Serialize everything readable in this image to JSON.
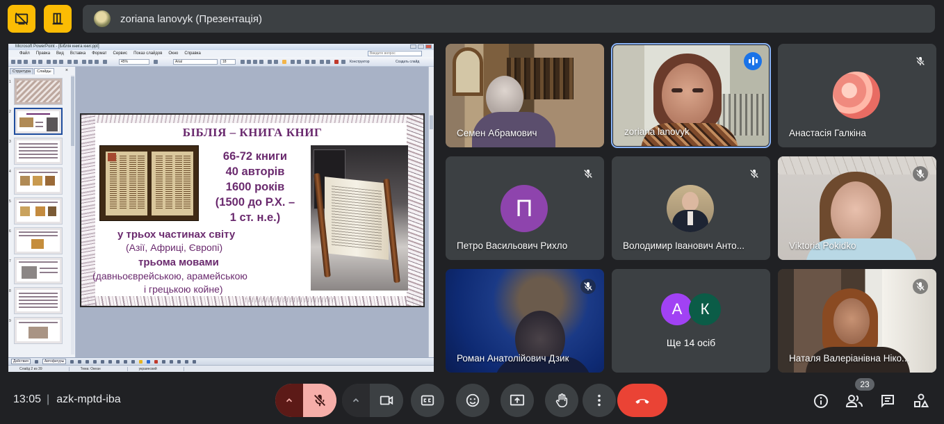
{
  "topbar": {
    "presenter_label": "zoriana lanovyk (Презентація)",
    "button_1_icon": "stop-presenting-icon",
    "button_2_icon": "present-layout-icon"
  },
  "presentation": {
    "app_title": "Microsoft PowerPoint - [Біблія книга книг.ppt]",
    "menu": [
      "Файл",
      "Правка",
      "Вид",
      "Вставка",
      "Формат",
      "Сервис",
      "Показ слайдов",
      "Окно",
      "Справка"
    ],
    "help_placeholder": "Введите вопрос",
    "zoom": "45%",
    "font_name": "Arial",
    "font_size": "18",
    "toolbar_design": "Конструктор",
    "toolbar_new_slide": "Создать слайд",
    "tabs": [
      "Структура",
      "Слайды"
    ],
    "thumb_numbers": [
      "1",
      "2",
      "3",
      "4",
      "5",
      "6",
      "7",
      "8",
      "9"
    ],
    "draw_label": "Действия",
    "autoshapes_label": "Автофигуры",
    "status": [
      "Слайд 2 из 39",
      "Тема: Океан",
      "украинский"
    ],
    "slide": {
      "title": "БІБЛІЯ – КНИГА КНИГ",
      "stats": [
        "66-72 книги",
        "40 авторів",
        "1600 років",
        "(1500 до Р.Х. –",
        "1 ст. н.е.)"
      ],
      "line1": "у трьох частинах світу",
      "line2": "(Азії, Африці, Європі)",
      "line3": "трьома мовами",
      "line4": "(давньоєврейською, арамейською",
      "line5": "і грецькою койне)"
    }
  },
  "participants": [
    {
      "name": "Семен Абрамович",
      "muted": false
    },
    {
      "name": "zoriana lanovyk",
      "speaking": true
    },
    {
      "name": "Анастасія Галкіна",
      "muted": true
    },
    {
      "name": "Петро Васильович Рихло",
      "avatar_letter": "П",
      "avatar_color": "#8e44ad",
      "muted": true
    },
    {
      "name": "Володимир Іванович Анто...",
      "muted": true
    },
    {
      "name": "Viktoria Pokidko",
      "muted": true
    },
    {
      "name": "Роман Анатолійович Дзик",
      "muted": true
    },
    {
      "others_label": "Ще 14 осіб",
      "letters": [
        "А",
        "К"
      ],
      "colors": [
        "#a142f4",
        "#0b5c47"
      ]
    },
    {
      "name": "Наталя Валеріанівна Ніко...",
      "muted": true
    }
  ],
  "bottom": {
    "time": "13:05",
    "meeting_code": "azk-mptd-iba",
    "participant_count": "23",
    "accent_red": "#ea4335"
  }
}
